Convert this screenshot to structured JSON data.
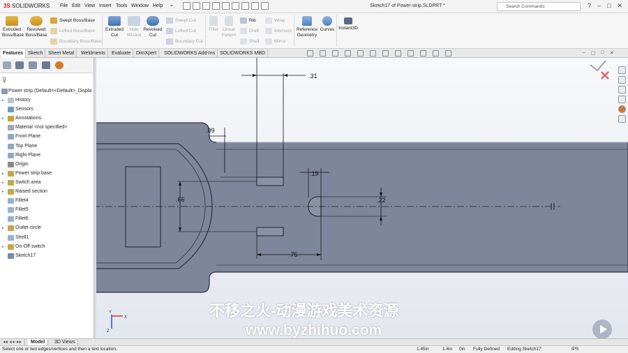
{
  "app": {
    "logo_prefix": "3S",
    "logo_name": "SOLIDWORKS",
    "menus": [
      "File",
      "Edit",
      "View",
      "Insert",
      "Tools",
      "Window",
      "Help"
    ],
    "pin_glyph": "📌",
    "window_title": "Sketch17 of Power strip.SLDPRT *",
    "search_placeholder": "Search Commands",
    "window_controls": [
      "?",
      "–",
      "□",
      "✕"
    ]
  },
  "ribbon": {
    "extruded_boss": "Extruded Boss/Base",
    "revolved_boss": "Revolved Boss/Base",
    "swept_boss": "Swept Boss/Base",
    "lofted_boss": "Lofted Boss/Base",
    "boundary_boss": "Boundary Boss/Base",
    "extruded_cut": "Extruded Cut",
    "hole_wizard": "Hole Wizard",
    "revolved_cut": "Revolved Cut",
    "swept_cut": "Swept Cut",
    "lofted_cut": "Lofted Cut",
    "boundary_cut": "Boundary Cut",
    "fillet": "Fillet",
    "linear_pattern": "Linear Pattern",
    "rib": "Rib",
    "draft": "Draft",
    "shell": "Shell",
    "wrap": "Wrap",
    "intersect": "Intersect",
    "mirror": "Mirror",
    "reference_geometry": "Reference Geometry",
    "curves": "Curves",
    "instant3d": "Instant3D"
  },
  "tabs": [
    "Features",
    "Sketch",
    "Sheet Metal",
    "Weldments",
    "Evaluate",
    "DimXpert",
    "SOLIDWORKS Add-Ins",
    "SOLIDWORKS MBD"
  ],
  "feature_tree": {
    "root": "Power strip  (Default<<Default>_Displa",
    "items": [
      {
        "label": "History",
        "expandable": true
      },
      {
        "label": "Sensors",
        "expandable": false
      },
      {
        "label": "Annotations",
        "expandable": true
      },
      {
        "label": "Material <not specified>",
        "expandable": false
      },
      {
        "label": "Front Plane",
        "expandable": false
      },
      {
        "label": "Top Plane",
        "expandable": false
      },
      {
        "label": "Right Plane",
        "expandable": false
      },
      {
        "label": "Origin",
        "expandable": false
      },
      {
        "label": "Power strip base",
        "expandable": true
      },
      {
        "label": "Switch area",
        "expandable": true
      },
      {
        "label": "Raised section",
        "expandable": true
      },
      {
        "label": "Fillet4",
        "expandable": false
      },
      {
        "label": "Fillet5",
        "expandable": false
      },
      {
        "label": "Fillet6",
        "expandable": false
      },
      {
        "label": "Outlet circle",
        "expandable": true
      },
      {
        "label": "Shell1",
        "expandable": false
      },
      {
        "label": "On-Off switch",
        "expandable": true
      },
      {
        "label": "Sketch17",
        "expandable": false
      }
    ]
  },
  "dimensions": {
    "d31": ".31",
    "d09": ".09",
    "d66": ".66",
    "d19": ".19",
    "d22": ".22",
    "d75": ".75"
  },
  "bottom_tabs": [
    "Model",
    "3D Views"
  ],
  "status": {
    "message": "Select one or two edges/vertices and then a text location.",
    "x": "1.45in",
    "y": "1.4in",
    "z": "0in",
    "state": "Fully Defined",
    "editing": "Editing Sketch17",
    "units": "IPS"
  },
  "watermark": {
    "line1": "不移之火-动漫游戏美术资源",
    "line2": "www.byzhihuo.com"
  },
  "colors": {
    "part_fill": "#7e869c",
    "part_edge": "#2c3142",
    "sketch_line": "#111111",
    "accent_blue": "#2a6fb8"
  }
}
